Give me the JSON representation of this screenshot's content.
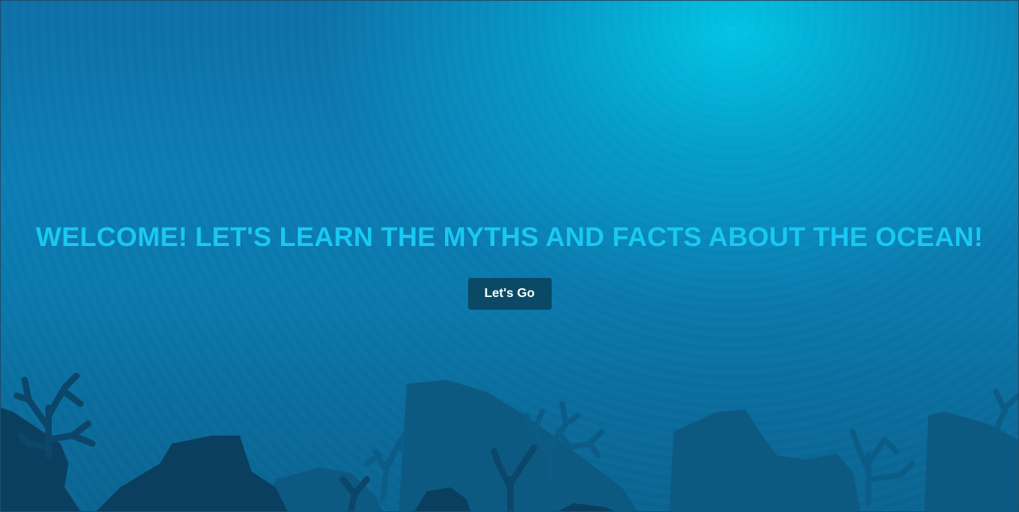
{
  "hero": {
    "headline": "WELCOME! LET'S LEARN THE MYTHS AND FACTS ABOUT THE OCEAN!",
    "cta_label": "Let's Go"
  },
  "colors": {
    "headline": "#19c8f2",
    "button_bg": "#0b4a66",
    "button_text": "#ffffff",
    "water_top": "#0d6fa6",
    "water_glow": "#00c8e6",
    "rock_dark": "#0a3d5c",
    "rock_mid": "#0c5076",
    "coral": "#0a4a6c"
  }
}
